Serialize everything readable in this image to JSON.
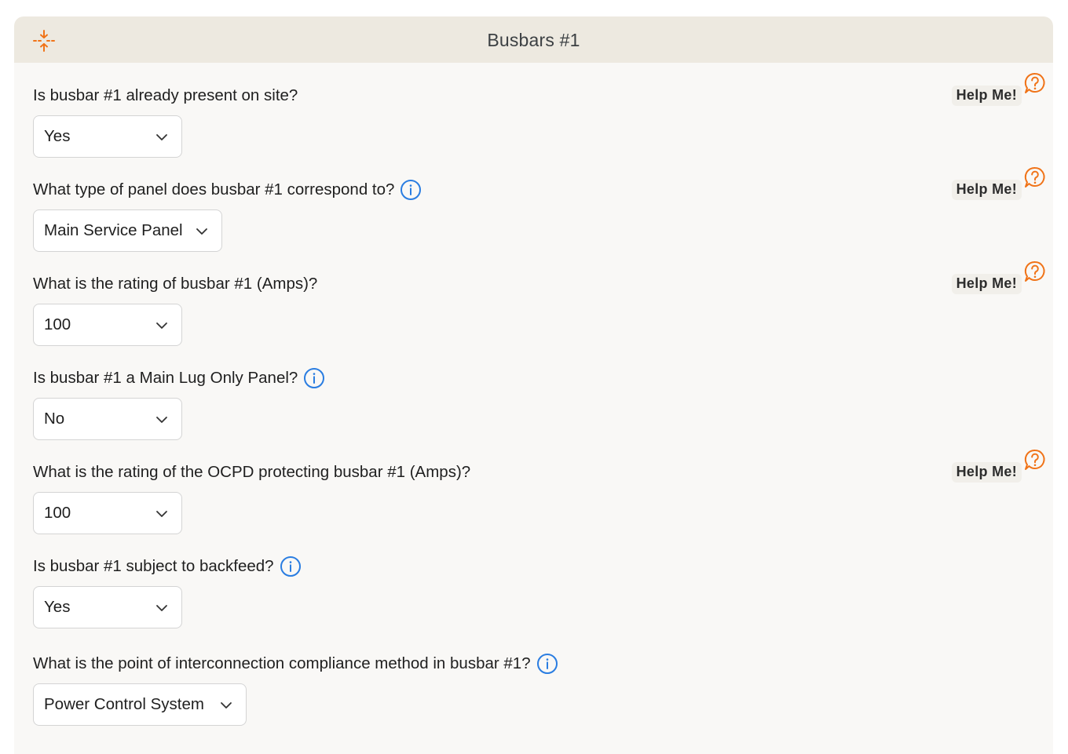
{
  "section": {
    "title": "Busbars #1"
  },
  "help_label": "Help Me!",
  "colors": {
    "accent_orange": "#f07318",
    "info_blue": "#2a7de1",
    "header_bg": "#ede9e0",
    "card_bg": "#f9f8f6"
  },
  "questions": [
    {
      "label": "Is busbar #1 already present on site?",
      "value": "Yes",
      "has_info": false,
      "has_help": true
    },
    {
      "label": "What type of panel does busbar #1 correspond to?",
      "value": "Main Service Panel",
      "has_info": true,
      "has_help": true
    },
    {
      "label": "What is the rating of busbar #1 (Amps)?",
      "value": "100",
      "has_info": false,
      "has_help": true
    },
    {
      "label": "Is busbar #1 a Main Lug Only Panel?",
      "value": "No",
      "has_info": true,
      "has_help": false
    },
    {
      "label": "What is the rating of the OCPD protecting busbar #1 (Amps)?",
      "value": "100",
      "has_info": false,
      "has_help": true
    },
    {
      "label": "Is busbar #1 subject to backfeed?",
      "value": "Yes",
      "has_info": true,
      "has_help": false
    },
    {
      "label": "What is the point of interconnection compliance method in busbar #1?",
      "value": "Power Control System",
      "has_info": true,
      "has_help": false
    }
  ]
}
